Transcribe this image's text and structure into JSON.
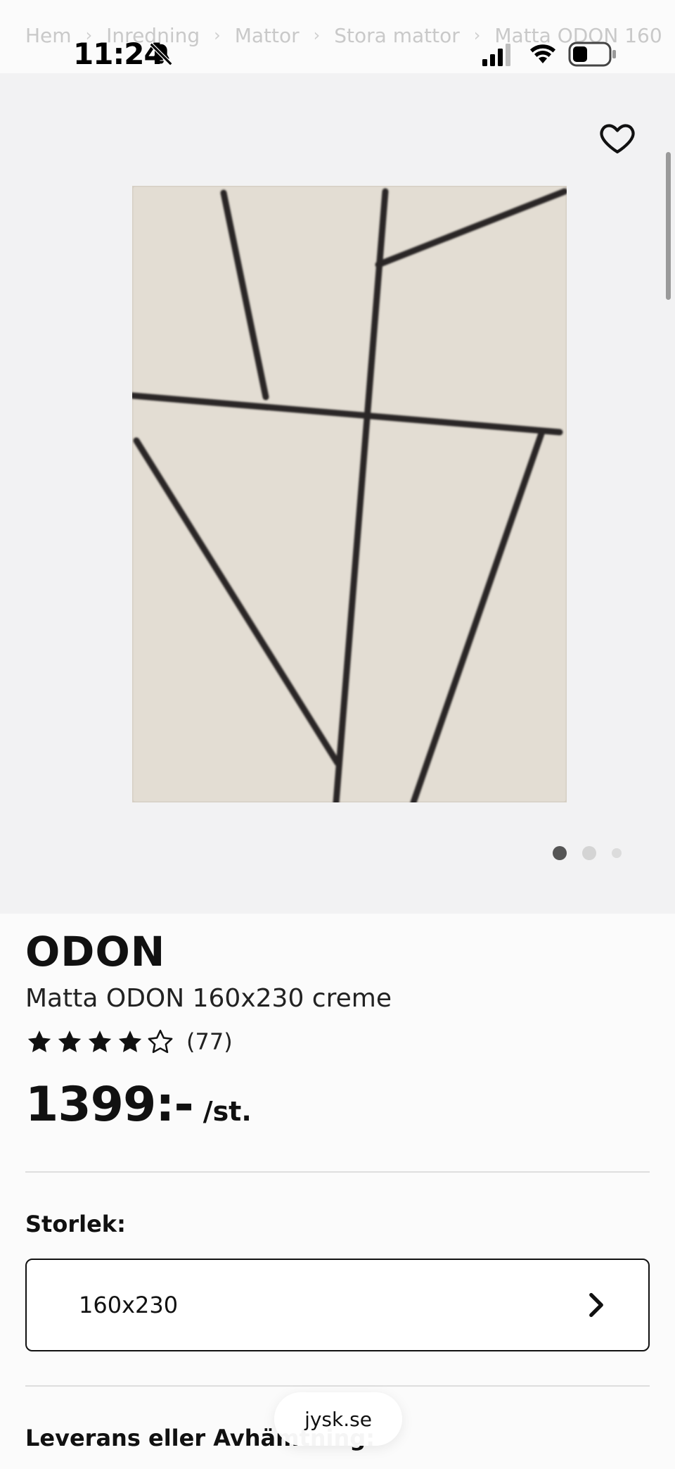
{
  "status_bar": {
    "time": "11:24",
    "icons": [
      "bell-slash-icon",
      "signal-icon",
      "wifi-icon",
      "battery-icon"
    ]
  },
  "breadcrumb": {
    "items": [
      "Hem",
      "Inredning",
      "Mattor",
      "Stora mattor",
      "Matta ODON 160"
    ],
    "separator": "›"
  },
  "product": {
    "brand": "ODON",
    "name": "Matta ODON 160x230 creme",
    "rating": 4.5,
    "rating_count": "(77)",
    "price": "1399:-",
    "price_unit": "/st.",
    "image_count": 3,
    "active_image": 1
  },
  "size": {
    "label": "Storlek:",
    "value": "160x230"
  },
  "delivery": {
    "heading": "Leverans eller Avhämtning:"
  },
  "browser": {
    "url": "jysk.se"
  },
  "colors": {
    "hero_background": "#f2f2f3",
    "rug": "#e3ddd3",
    "rug_lines": "#2a2826",
    "text": "#111111"
  }
}
